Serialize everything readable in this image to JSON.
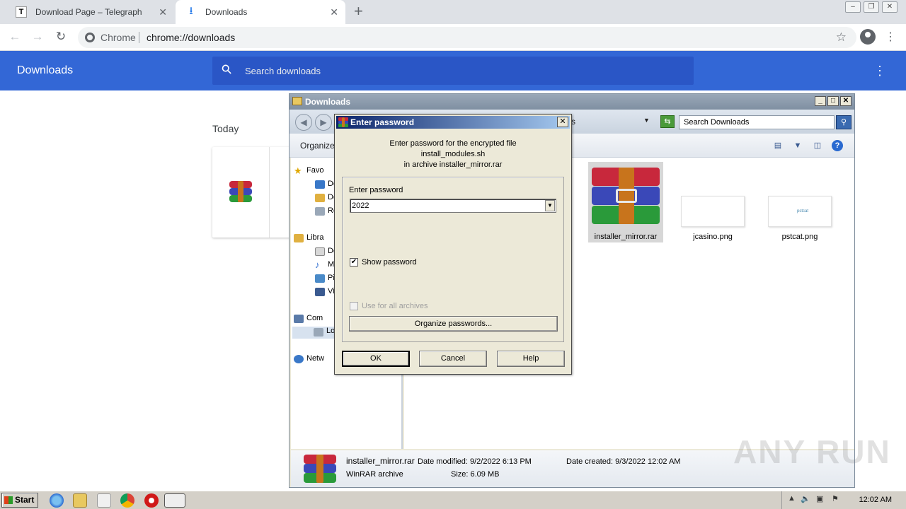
{
  "browser": {
    "tabs": [
      {
        "title": "Download Page – Telegraph",
        "favicon": "T"
      },
      {
        "title": "Downloads"
      }
    ],
    "omnibox": {
      "site": "Chrome",
      "url": "chrome://downloads"
    }
  },
  "downloads_page": {
    "title": "Downloads",
    "search_placeholder": "Search downloads",
    "section_heading": "Today"
  },
  "explorer": {
    "title": "Downloads",
    "address_tail": "s",
    "search_placeholder": "Search Downloads",
    "organize_label": "Organize",
    "nav_items": [
      {
        "label": "Favo",
        "icon": "star-icon"
      },
      {
        "label": "De",
        "icon": "desktop-icon"
      },
      {
        "label": "Do",
        "icon": "downloads-folder-icon"
      },
      {
        "label": "Re",
        "icon": "recent-places-icon"
      },
      {
        "label": "Libra",
        "icon": "libraries-icon"
      },
      {
        "label": "Do",
        "icon": "documents-icon"
      },
      {
        "label": "Mu",
        "icon": "music-icon"
      },
      {
        "label": "Pic",
        "icon": "pictures-icon"
      },
      {
        "label": "Vi",
        "icon": "videos-icon"
      },
      {
        "label": "Com",
        "icon": "computer-icon"
      },
      {
        "label": "Lo",
        "icon": "local-disk-icon"
      },
      {
        "label": "Netw",
        "icon": "network-icon"
      }
    ],
    "files": [
      {
        "name": "installer_mirror.rar"
      },
      {
        "name": "jcasino.png"
      },
      {
        "name": "pstcat.png",
        "thumb_text": "pstcat"
      }
    ],
    "details": {
      "filename": "installer_mirror.rar",
      "type": "WinRAR archive",
      "modified": "Date modified: 9/2/2022 6:13 PM",
      "size": "Size: 6.09 MB",
      "created": "Date created: 9/3/2022 12:02 AM"
    }
  },
  "dialog": {
    "title": "Enter password",
    "message_line1": "Enter password for the encrypted file",
    "message_line2": "install_modules.sh",
    "message_line3": "in archive installer_mirror.rar",
    "password_label": "Enter password",
    "password_value": "2022",
    "show_password_label": "Show password",
    "show_password_checked": true,
    "use_all_label": "Use for all archives",
    "use_all_checked": false,
    "organize_button": "Organize passwords...",
    "ok_button": "OK",
    "cancel_button": "Cancel",
    "help_button": "Help"
  },
  "taskbar": {
    "start_label": "Start",
    "clock": "12:02 AM"
  },
  "watermark": "ANY RUN",
  "colors": {
    "downloads_header": "#3367d6",
    "dialog_title_start": "#0a246a",
    "dialog_title_end": "#a6caf0"
  }
}
